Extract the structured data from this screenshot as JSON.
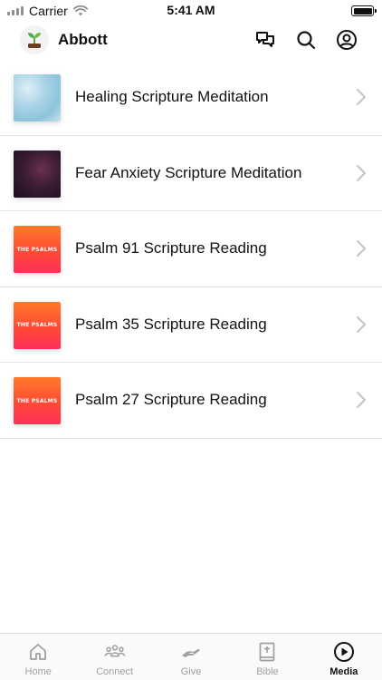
{
  "status_bar": {
    "carrier": "Carrier",
    "time": "5:41 AM"
  },
  "header": {
    "church_name": "Abbott",
    "icons": [
      "chat-icon",
      "search-icon",
      "profile-icon"
    ]
  },
  "media_items": [
    {
      "title": "Healing Scripture Meditation",
      "thumb": "sky"
    },
    {
      "title": "Fear Anxiety Scripture Meditation",
      "thumb": "nebula"
    },
    {
      "title": "Psalm 91 Scripture Reading",
      "thumb": "psalms",
      "thumb_text": "THE PSALMS"
    },
    {
      "title": "Psalm 35 Scripture Reading",
      "thumb": "psalms",
      "thumb_text": "THE PSALMS"
    },
    {
      "title": "Psalm 27 Scripture Reading",
      "thumb": "psalms",
      "thumb_text": "THE PSALMS"
    }
  ],
  "tabs": [
    {
      "label": "Home",
      "icon": "home-icon",
      "active": false
    },
    {
      "label": "Connect",
      "icon": "people-icon",
      "active": false
    },
    {
      "label": "Give",
      "icon": "give-hand-icon",
      "active": false
    },
    {
      "label": "Bible",
      "icon": "bible-icon",
      "active": false
    },
    {
      "label": "Media",
      "icon": "play-icon",
      "active": true
    }
  ],
  "colors": {
    "active_tab": "#111111",
    "inactive_tab": "#a0a0a0",
    "divider": "#e4e4e4"
  }
}
